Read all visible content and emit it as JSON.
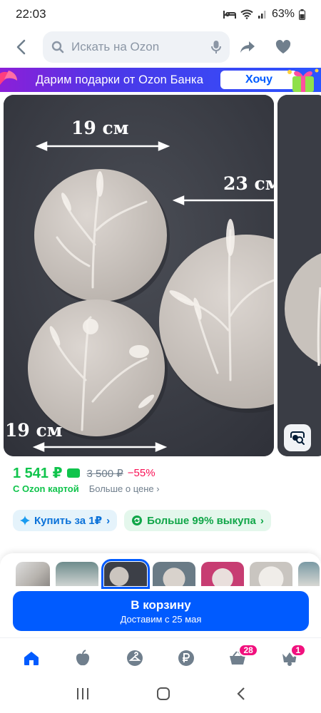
{
  "status_bar": {
    "time": "22:03",
    "battery": "63%"
  },
  "header": {
    "search_placeholder": "Искать на Ozon"
  },
  "promo": {
    "text": "Дарим подарки от Ozon Банка",
    "button": "Хочу"
  },
  "gallery": {
    "dim_top": "19 см",
    "dim_right": "23 см",
    "dim_bottom": "19 см"
  },
  "price": {
    "current": "1 541 ₽",
    "old": "3 500 ₽",
    "discount": "−55%",
    "with_card": "С Ozon картой",
    "more_price": "Больше о цене"
  },
  "chips": [
    {
      "label": "Купить за 1₽",
      "icon": "sparkle-icon"
    },
    {
      "label": "Больше 99% выкупа",
      "icon": "refresh-icon"
    }
  ],
  "cart": {
    "label": "В корзину",
    "delivery": "Доставим с 25 мая"
  },
  "nav": {
    "cart_badge": "28",
    "profile_badge": "1"
  },
  "colors": {
    "brand_blue": "#005bff",
    "price_green": "#10c44c",
    "discount_pink": "#f91155",
    "badge_pink": "#f1117e"
  }
}
